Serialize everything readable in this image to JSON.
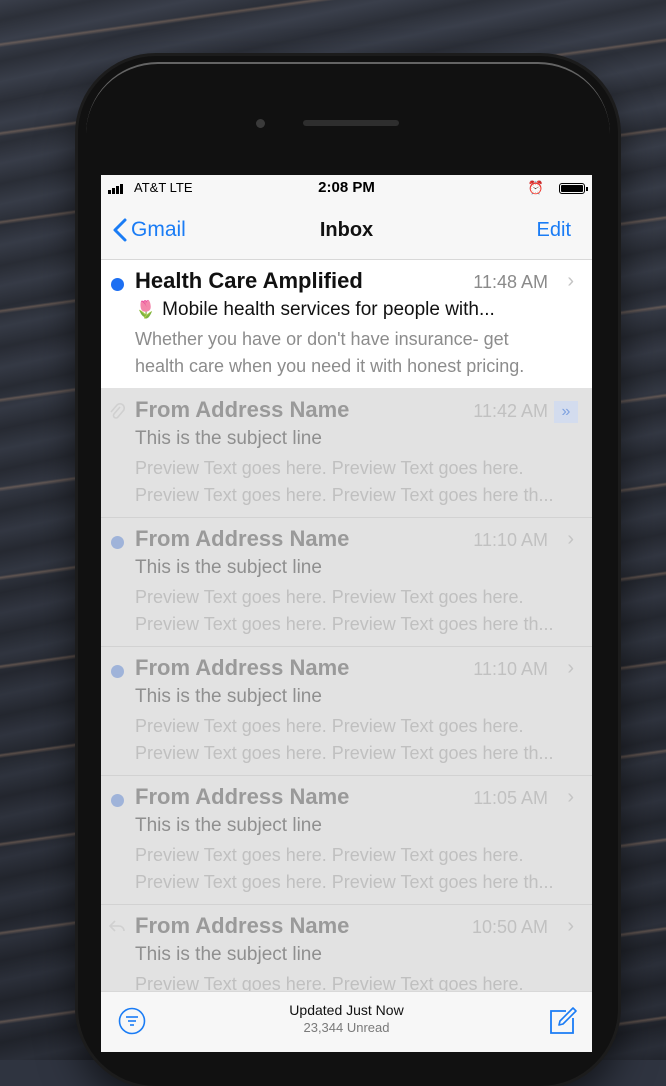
{
  "status": {
    "carrier": "AT&T  LTE",
    "time": "2:08 PM"
  },
  "nav": {
    "back_label": "Gmail",
    "title": "Inbox",
    "edit_label": "Edit"
  },
  "emails": [
    {
      "from": "Health Care Amplified",
      "time": "11:48 AM",
      "subject_emoji": "🌷",
      "subject": "Mobile health services for people with...",
      "preview_line1": "Whether you have or don't have insurance- get",
      "preview_line2": "health care when you need it with honest pricing."
    },
    {
      "from": "From Address Name",
      "time": "11:42 AM",
      "subject": "This is the subject line",
      "preview_line1": "Preview Text goes here. Preview Text goes here.",
      "preview_line2": "Preview Text goes here. Preview Text goes here th..."
    },
    {
      "from": "From Address Name",
      "time": "11:10 AM",
      "subject": "This is the subject line",
      "preview_line1": "Preview Text goes here. Preview Text goes here.",
      "preview_line2": "Preview Text goes here. Preview Text goes here th..."
    },
    {
      "from": "From Address Name",
      "time": "11:10 AM",
      "subject": "This is the subject line",
      "preview_line1": "Preview Text goes here. Preview Text goes here.",
      "preview_line2": "Preview Text goes here. Preview Text goes here th..."
    },
    {
      "from": "From Address Name",
      "time": "11:05 AM",
      "subject": "This is the subject line",
      "preview_line1": "Preview Text goes here. Preview Text goes here.",
      "preview_line2": "Preview Text goes here. Preview Text goes here th..."
    },
    {
      "from": "From Address Name",
      "time": "10:50 AM",
      "subject": "This is the subject line",
      "preview_line1": "Preview Text goes here. Preview Text goes here.",
      "preview_line2": ""
    }
  ],
  "toolbar": {
    "updated": "Updated Just Now",
    "unread": "23,344 Unread"
  },
  "colors": {
    "accent": "#1a7cf5",
    "unread_dot": "#1d6ff2"
  }
}
